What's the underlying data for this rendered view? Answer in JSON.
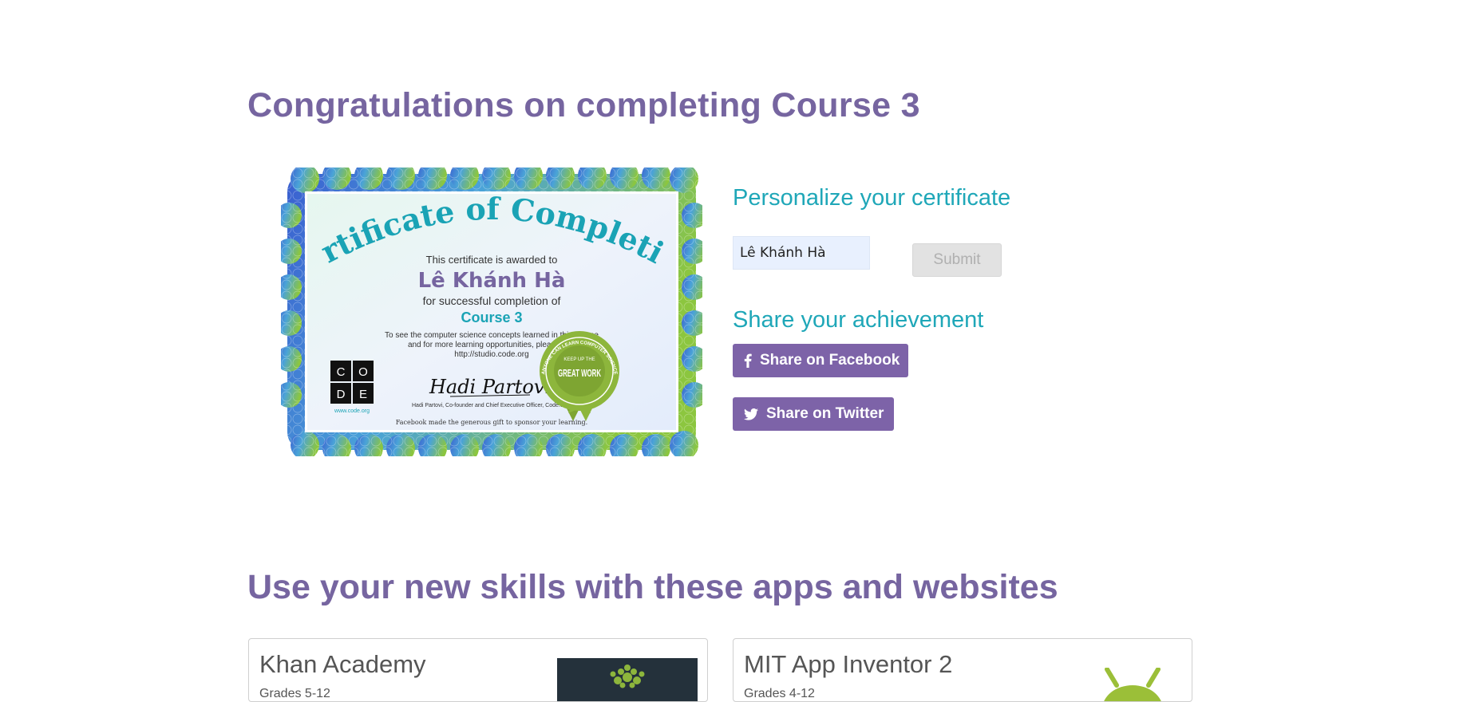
{
  "page": {
    "title": "Congratulations on completing Course 3"
  },
  "certificate": {
    "heading": "Certificate of Completion",
    "awarded_text": "This certificate is awarded to",
    "recipient": "Lê Khánh Hà",
    "completion_text": "for successful completion of",
    "course": "Course 3",
    "info_line1": "To see the computer science concepts learned in this course",
    "info_line2": "and for more learning opportunities, please visit",
    "info_url": "http://studio.code.org",
    "logo_letters": [
      "C",
      "O",
      "D",
      "E"
    ],
    "logo_url": "www.code.org",
    "signature": "Hadi Partovi",
    "signer_caption": "Hadi Partovi, Co-founder and Chief Executive Officer, Code.org",
    "badge_text": "GREAT WORK",
    "badge_subtext": "KEEP UP THE",
    "badge_ring_text": "ANYONE CAN LEARN COMPUTER SCIENCE",
    "sponsor_text": "Facebook made the generous gift to sponsor your learning."
  },
  "personalize": {
    "heading": "Personalize your certificate",
    "name_value": "Lê Khánh Hà",
    "submit_label": "Submit"
  },
  "share": {
    "heading": "Share your achievement",
    "facebook_label": "Share on Facebook",
    "twitter_label": "Share on Twitter"
  },
  "apps": {
    "heading": "Use your new skills with these apps and websites",
    "cards": [
      {
        "name": "Khan Academy",
        "subtitle": "Grades 5-12",
        "icon": "khan-academy-tree-logo"
      },
      {
        "name": "MIT App Inventor 2",
        "subtitle": "Grades 4-12",
        "icon": "android-logo"
      }
    ]
  },
  "colors": {
    "title_purple": "#7665a0",
    "heading_teal": "#1fa7b8",
    "button_purple": "#7d63a8",
    "certificate_heading": "#1aa3b5",
    "badge_green": "#8db63c"
  }
}
